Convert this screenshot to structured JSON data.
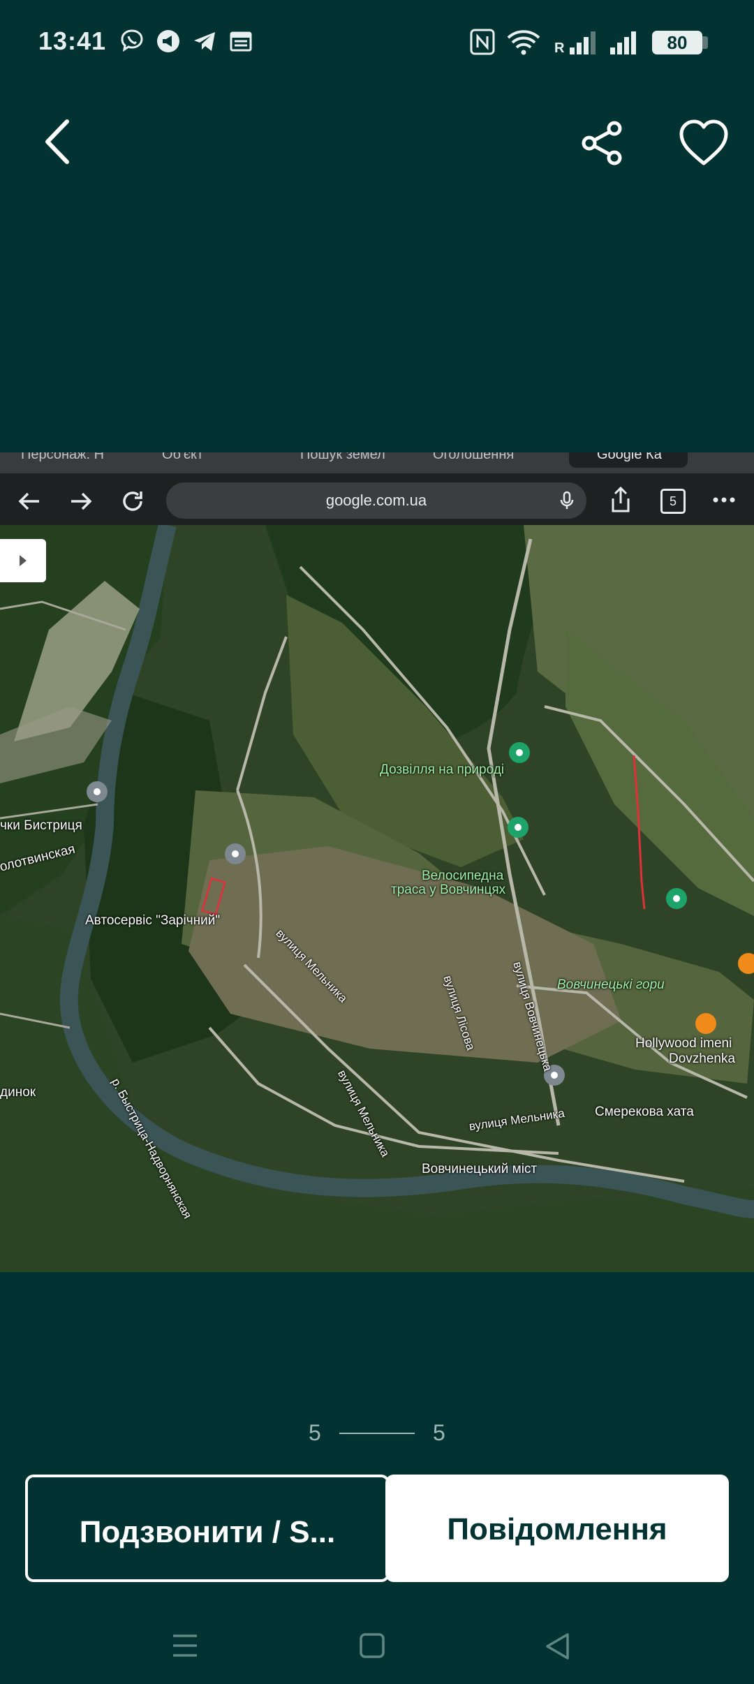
{
  "status_bar": {
    "time": "13:41",
    "battery": "80",
    "network_roaming": "R"
  },
  "browser": {
    "tabs": [
      "Персонаж: Н",
      "Об'єкт",
      "Пошук земел",
      "Оголошення",
      "Google Ка"
    ],
    "url": "google.com.ua",
    "tab_count": "5"
  },
  "map": {
    "labels": {
      "dozvillia": "Дозвілля на природі",
      "bystrytsia": "чки Бистриця",
      "solotvynska": "олотвинская",
      "autoservice": "Автосервіс \"Зарічний\"",
      "bike_route_1": "Велосипедна",
      "bike_route_2": "траса у Вовчинцях",
      "street_melnyka_1": "вулиця Мельника",
      "street_lysova": "вулиця Лісова",
      "street_vovchynetska": "вулиця Вовчинецька",
      "vovchynetski_hory": "Вовчинецькі гори",
      "hollywood_1": "Hollywood imeni",
      "hollywood_2": "Dovzhenka",
      "river": "р. Быстрица-Надворнянская",
      "street_melnyka_2": "вулиця Мельника",
      "smerekova": "Смерекова хата",
      "street_melnyka_3": "вулиця Мельника",
      "dynok": "динок",
      "bridge": "Вовчинецький міст"
    }
  },
  "pager": {
    "current": "5",
    "total": "5"
  },
  "actions": {
    "call_label": "Подзвонити / S...",
    "message_label": "Повідомлення"
  },
  "colors": {
    "background": "#023232",
    "accent_text": "#9fb8b6"
  }
}
